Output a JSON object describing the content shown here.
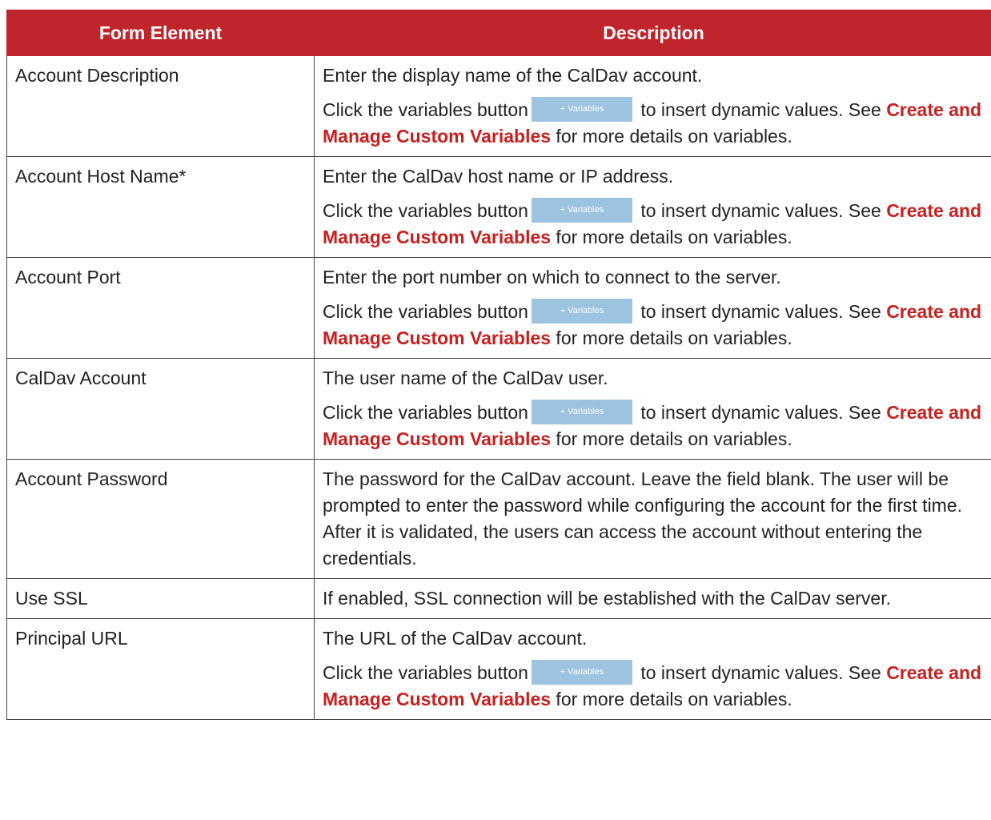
{
  "header": {
    "col1": "Form Element",
    "col2": "Description"
  },
  "variables_button_label": "+ Variables",
  "rows": [
    {
      "element": "Account Description",
      "description": "Enter the display name of the CalDav account.",
      "has_variables": true,
      "pre": "Click the variables button",
      "mid": " to insert dynamic values. See ",
      "link": "Create and Manage Custom Variables",
      "post": " for more details on variables."
    },
    {
      "element": "Account Host Name*",
      "description": "Enter the CalDav host name or IP address.",
      "has_variables": true,
      "pre": "Click the variables button",
      "mid": " to insert dynamic values. See ",
      "link": "Create and Manage Custom Variables",
      "post": " for more details on variables."
    },
    {
      "element": "Account Port",
      "description": "Enter the port number on which to connect to the server.",
      "has_variables": true,
      "pre": "Click the variables button",
      "mid": " to insert dynamic values. See ",
      "link": "Create and Manage Custom Variables",
      "post": " for more details on variables."
    },
    {
      "element": "CalDav Account",
      "description": "The user name of the CalDav user.",
      "has_variables": true,
      "pre": "Click the variables button",
      "mid": " to insert dynamic values. See ",
      "link": "Create and Manage Custom Variables",
      "post": " for more details on variables."
    },
    {
      "element": "Account Password",
      "description": "The password for the CalDav account. Leave the field blank. The user will be prompted to enter the password while configuring the account for the first time. After it is validated, the users can access the account without entering the credentials.",
      "has_variables": false
    },
    {
      "element": "Use SSL",
      "description": "If enabled, SSL connection will be established with the CalDav server.",
      "has_variables": false
    },
    {
      "element": "Principal URL",
      "description": "The URL of the CalDav account.",
      "has_variables": true,
      "pre": "Click the variables button",
      "mid": " to insert dynamic values. See ",
      "link": "Create and Manage Custom Variables",
      "post": " for more details on variables."
    }
  ],
  "colors": {
    "header_bg": "#c0252c",
    "link": "#c8201e",
    "variables_button": "#9cc3e0"
  }
}
